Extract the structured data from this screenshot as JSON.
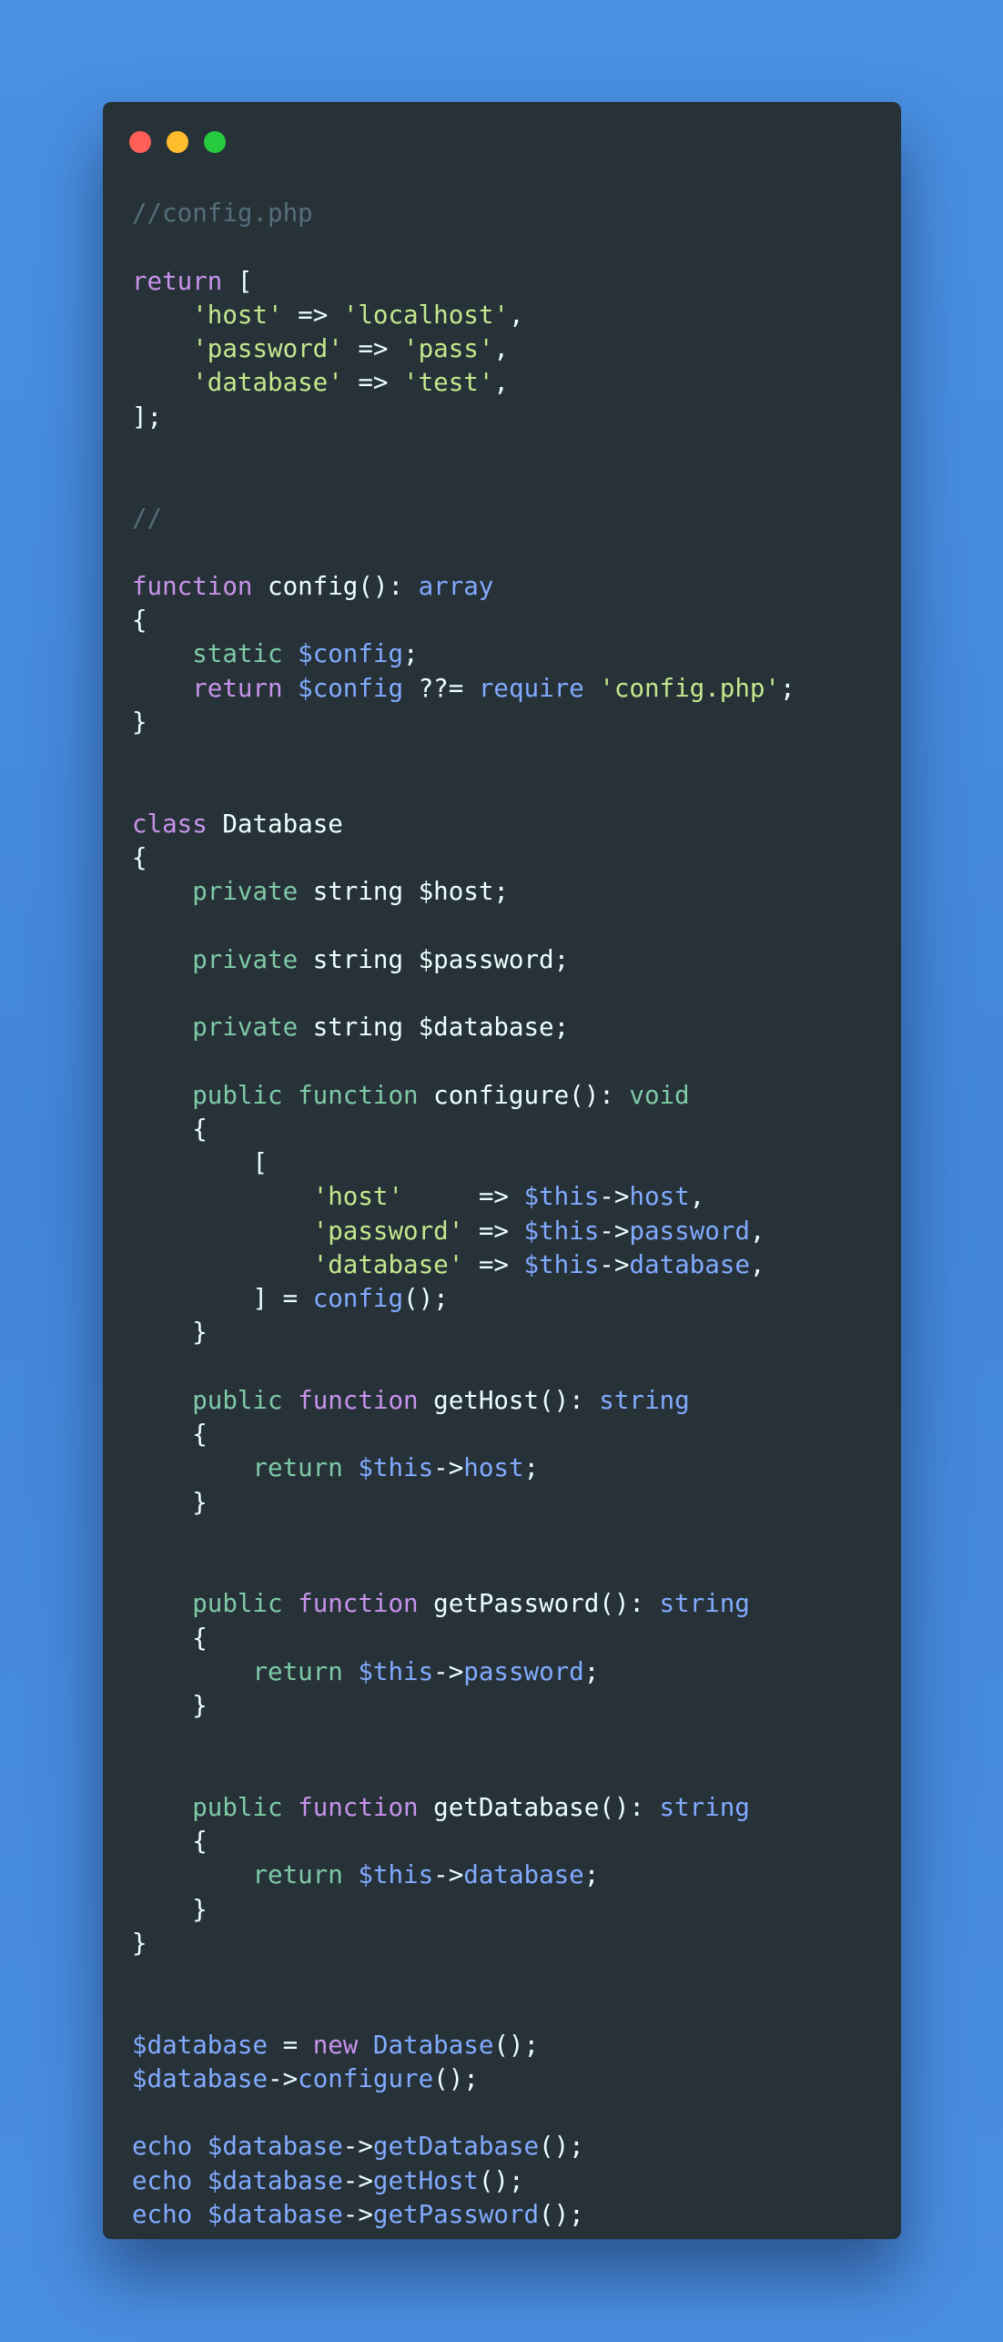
{
  "window": {
    "controls": [
      {
        "name": "close",
        "color": "#ff5f56"
      },
      {
        "name": "minimize",
        "color": "#ffbd2e"
      },
      {
        "name": "maximize",
        "color": "#27c93f"
      }
    ]
  },
  "colors": {
    "background": "#4a90e2",
    "editor": "#263238",
    "keyword": "#c792ea",
    "modifier": "#7fc9a6",
    "function": "#82aaff",
    "string": "#c3e88d",
    "comment": "#546e7a",
    "text": "#eeffff"
  },
  "code": {
    "language": "php",
    "lines": [
      [
        [
          "c",
          "//config.php"
        ]
      ],
      [],
      [
        [
          "k",
          "return"
        ],
        [
          "p",
          " ["
        ]
      ],
      [
        [
          "p",
          "    "
        ],
        [
          "s",
          "'host'"
        ],
        [
          "p",
          " => "
        ],
        [
          "s",
          "'localhost'"
        ],
        [
          "p",
          ","
        ]
      ],
      [
        [
          "p",
          "    "
        ],
        [
          "s",
          "'password'"
        ],
        [
          "p",
          " => "
        ],
        [
          "s",
          "'pass'"
        ],
        [
          "p",
          ","
        ]
      ],
      [
        [
          "p",
          "    "
        ],
        [
          "s",
          "'database'"
        ],
        [
          "p",
          " => "
        ],
        [
          "s",
          "'test'"
        ],
        [
          "p",
          ","
        ]
      ],
      [
        [
          "p",
          "];"
        ]
      ],
      [],
      [],
      [
        [
          "c",
          "//"
        ]
      ],
      [],
      [
        [
          "k",
          "function"
        ],
        [
          "p",
          " config(): "
        ],
        [
          "f",
          "array"
        ]
      ],
      [
        [
          "p",
          "{"
        ]
      ],
      [
        [
          "p",
          "    "
        ],
        [
          "m",
          "static"
        ],
        [
          "p",
          " "
        ],
        [
          "f",
          "$config"
        ],
        [
          "p",
          ";"
        ]
      ],
      [
        [
          "p",
          "    "
        ],
        [
          "k",
          "return"
        ],
        [
          "p",
          " "
        ],
        [
          "f",
          "$config"
        ],
        [
          "p",
          " ??= "
        ],
        [
          "f",
          "require"
        ],
        [
          "p",
          " "
        ],
        [
          "s",
          "'config.php'"
        ],
        [
          "p",
          ";"
        ]
      ],
      [
        [
          "p",
          "}"
        ]
      ],
      [],
      [],
      [
        [
          "k",
          "class"
        ],
        [
          "p",
          " Database"
        ]
      ],
      [
        [
          "p",
          "{"
        ]
      ],
      [
        [
          "p",
          "    "
        ],
        [
          "m",
          "private"
        ],
        [
          "p",
          " string $host;"
        ]
      ],
      [],
      [
        [
          "p",
          "    "
        ],
        [
          "m",
          "private"
        ],
        [
          "p",
          " string $password;"
        ]
      ],
      [],
      [
        [
          "p",
          "    "
        ],
        [
          "m",
          "private"
        ],
        [
          "p",
          " string $database;"
        ]
      ],
      [],
      [
        [
          "p",
          "    "
        ],
        [
          "m",
          "public function"
        ],
        [
          "p",
          " configure(): "
        ],
        [
          "m",
          "void"
        ]
      ],
      [
        [
          "p",
          "    {"
        ]
      ],
      [
        [
          "p",
          "        ["
        ]
      ],
      [
        [
          "p",
          "            "
        ],
        [
          "s",
          "'host'"
        ],
        [
          "p",
          "     => "
        ],
        [
          "f",
          "$this"
        ],
        [
          "p",
          "->"
        ],
        [
          "f",
          "host"
        ],
        [
          "p",
          ","
        ]
      ],
      [
        [
          "p",
          "            "
        ],
        [
          "s",
          "'password'"
        ],
        [
          "p",
          " => "
        ],
        [
          "f",
          "$this"
        ],
        [
          "p",
          "->"
        ],
        [
          "f",
          "password"
        ],
        [
          "p",
          ","
        ]
      ],
      [
        [
          "p",
          "            "
        ],
        [
          "s",
          "'database'"
        ],
        [
          "p",
          " => "
        ],
        [
          "f",
          "$this"
        ],
        [
          "p",
          "->"
        ],
        [
          "f",
          "database"
        ],
        [
          "p",
          ","
        ]
      ],
      [
        [
          "p",
          "        ] = "
        ],
        [
          "f",
          "config"
        ],
        [
          "p",
          "();"
        ]
      ],
      [
        [
          "p",
          "    }"
        ]
      ],
      [],
      [
        [
          "p",
          "    "
        ],
        [
          "m",
          "public"
        ],
        [
          "p",
          " "
        ],
        [
          "k",
          "function"
        ],
        [
          "p",
          " getHost(): "
        ],
        [
          "f",
          "string"
        ]
      ],
      [
        [
          "p",
          "    {"
        ]
      ],
      [
        [
          "p",
          "        "
        ],
        [
          "m",
          "return"
        ],
        [
          "p",
          " "
        ],
        [
          "f",
          "$this"
        ],
        [
          "p",
          "->"
        ],
        [
          "f",
          "host"
        ],
        [
          "p",
          ";"
        ]
      ],
      [
        [
          "p",
          "    }"
        ]
      ],
      [],
      [],
      [
        [
          "p",
          "    "
        ],
        [
          "m",
          "public"
        ],
        [
          "p",
          " "
        ],
        [
          "k",
          "function"
        ],
        [
          "p",
          " getPassword(): "
        ],
        [
          "f",
          "string"
        ]
      ],
      [
        [
          "p",
          "    {"
        ]
      ],
      [
        [
          "p",
          "        "
        ],
        [
          "m",
          "return"
        ],
        [
          "p",
          " "
        ],
        [
          "f",
          "$this"
        ],
        [
          "p",
          "->"
        ],
        [
          "f",
          "password"
        ],
        [
          "p",
          ";"
        ]
      ],
      [
        [
          "p",
          "    }"
        ]
      ],
      [],
      [],
      [
        [
          "p",
          "    "
        ],
        [
          "m",
          "public"
        ],
        [
          "p",
          " "
        ],
        [
          "k",
          "function"
        ],
        [
          "p",
          " getDatabase(): "
        ],
        [
          "f",
          "string"
        ]
      ],
      [
        [
          "p",
          "    {"
        ]
      ],
      [
        [
          "p",
          "        "
        ],
        [
          "m",
          "return"
        ],
        [
          "p",
          " "
        ],
        [
          "f",
          "$this"
        ],
        [
          "p",
          "->"
        ],
        [
          "f",
          "database"
        ],
        [
          "p",
          ";"
        ]
      ],
      [
        [
          "p",
          "    }"
        ]
      ],
      [
        [
          "p",
          "}"
        ]
      ],
      [],
      [],
      [
        [
          "f",
          "$database"
        ],
        [
          "p",
          " = "
        ],
        [
          "k",
          "new"
        ],
        [
          "p",
          " "
        ],
        [
          "f",
          "Database"
        ],
        [
          "p",
          "();"
        ]
      ],
      [
        [
          "f",
          "$database"
        ],
        [
          "p",
          "->"
        ],
        [
          "f",
          "configure"
        ],
        [
          "p",
          "();"
        ]
      ],
      [],
      [
        [
          "f",
          "echo $database"
        ],
        [
          "p",
          "->"
        ],
        [
          "f",
          "getDatabase"
        ],
        [
          "p",
          "();"
        ]
      ],
      [
        [
          "f",
          "echo $database"
        ],
        [
          "p",
          "->"
        ],
        [
          "f",
          "getHost"
        ],
        [
          "p",
          "();"
        ]
      ],
      [
        [
          "f",
          "echo $database"
        ],
        [
          "p",
          "->"
        ],
        [
          "f",
          "getPassword"
        ],
        [
          "p",
          "();"
        ]
      ]
    ]
  }
}
